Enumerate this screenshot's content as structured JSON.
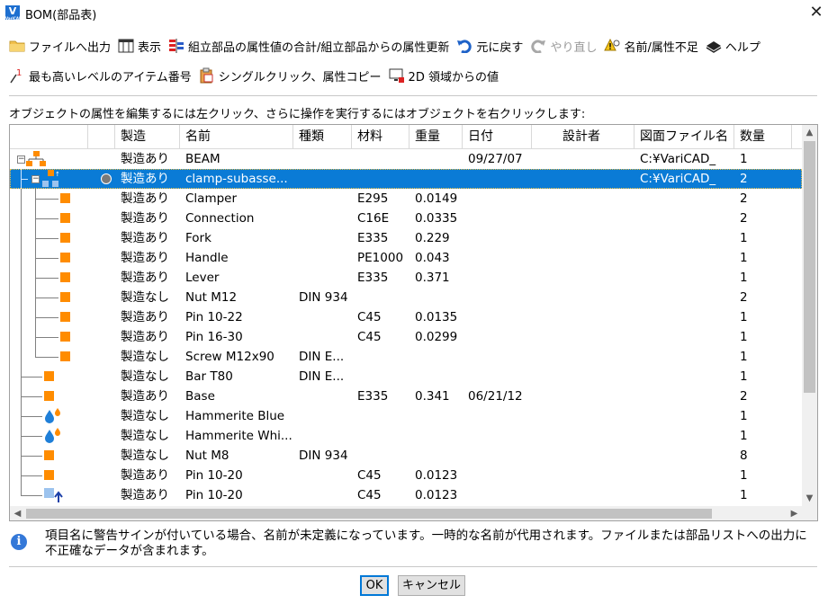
{
  "window": {
    "title": "BOM(部品表)",
    "app_icon_letter": "V",
    "app_icon_sub": "VariCAD"
  },
  "toolbar1": [
    {
      "label": "ファイルへ出力",
      "icon": "folder-icon"
    },
    {
      "label": "表示",
      "icon": "columns-icon"
    },
    {
      "label": "組立部品の属性値の合計/組立部品からの属性更新",
      "icon": "assembly-sum-icon"
    },
    {
      "label": "元に戻す",
      "icon": "undo-icon"
    },
    {
      "label": "やり直し",
      "icon": "redo-icon"
    },
    {
      "label": "名前/属性不足",
      "icon": "warning-icon"
    },
    {
      "label": "ヘルプ",
      "icon": "help-book-icon"
    }
  ],
  "toolbar2": [
    {
      "label": "最も高いレベルのアイテム番号",
      "icon": "top-level-number-icon"
    },
    {
      "label": "シングルクリック、属性コピー",
      "icon": "copy-attribute-icon"
    },
    {
      "label": "2D 領域からの値",
      "icon": "2d-area-icon"
    }
  ],
  "instruction": "オブジェクトの属性を編集するには左クリック、さらに操作を実行するにはオブジェクトを右クリックします:",
  "columns": [
    "製造",
    "名前",
    "種類",
    "材料",
    "重量",
    "日付",
    "設計者",
    "図面ファイル名",
    "数量"
  ],
  "rows": [
    {
      "icon": "assembly",
      "level": 0,
      "expander": "minus",
      "mfg": "製造あり",
      "name": "BEAM",
      "type": "",
      "material": "",
      "weight": "",
      "date": "09/27/07",
      "designer": "",
      "file": "C:¥VariCAD_",
      "qty": "1"
    },
    {
      "icon": "subassembly",
      "level": 1,
      "expander": "minus",
      "selected": true,
      "mfg": "製造あり",
      "name": "clamp-subasse...",
      "type": "",
      "material": "",
      "weight": "",
      "date": "",
      "designer": "",
      "file": "C:¥VariCAD_",
      "qty": "2"
    },
    {
      "icon": "part",
      "level": 2,
      "mfg": "製造あり",
      "name": "Clamper",
      "type": "",
      "material": "E295",
      "weight": "0.0149",
      "date": "",
      "designer": "",
      "file": "",
      "qty": "2"
    },
    {
      "icon": "part",
      "level": 2,
      "mfg": "製造あり",
      "name": "Connection",
      "type": "",
      "material": "C16E",
      "weight": "0.0335",
      "date": "",
      "designer": "",
      "file": "",
      "qty": "2"
    },
    {
      "icon": "part",
      "level": 2,
      "mfg": "製造あり",
      "name": "Fork",
      "type": "",
      "material": "E335",
      "weight": "0.229",
      "date": "",
      "designer": "",
      "file": "",
      "qty": "1"
    },
    {
      "icon": "part",
      "level": 2,
      "mfg": "製造あり",
      "name": "Handle",
      "type": "",
      "material": "PE1000",
      "weight": "0.043",
      "date": "",
      "designer": "",
      "file": "",
      "qty": "1"
    },
    {
      "icon": "part",
      "level": 2,
      "mfg": "製造あり",
      "name": "Lever",
      "type": "",
      "material": "E335",
      "weight": "0.371",
      "date": "",
      "designer": "",
      "file": "",
      "qty": "1"
    },
    {
      "icon": "part",
      "level": 2,
      "mfg": "製造なし",
      "name": "Nut M12",
      "type": "DIN 934",
      "material": "",
      "weight": "",
      "date": "",
      "designer": "",
      "file": "",
      "qty": "2"
    },
    {
      "icon": "part",
      "level": 2,
      "mfg": "製造あり",
      "name": "Pin 10-22",
      "type": "",
      "material": "C45",
      "weight": "0.0135",
      "date": "",
      "designer": "",
      "file": "",
      "qty": "1"
    },
    {
      "icon": "part",
      "level": 2,
      "mfg": "製造あり",
      "name": "Pin 16-30",
      "type": "",
      "material": "C45",
      "weight": "0.0299",
      "date": "",
      "designer": "",
      "file": "",
      "qty": "1"
    },
    {
      "icon": "part",
      "level": 2,
      "last": true,
      "mfg": "製造なし",
      "name": "Screw M12x90",
      "type": "DIN E...",
      "material": "",
      "weight": "",
      "date": "",
      "designer": "",
      "file": "",
      "qty": "1"
    },
    {
      "icon": "part",
      "level": 1,
      "mfg": "製造なし",
      "name": "Bar T80",
      "type": "DIN E...",
      "material": "",
      "weight": "",
      "date": "",
      "designer": "",
      "file": "",
      "qty": "1"
    },
    {
      "icon": "part",
      "level": 1,
      "mfg": "製造あり",
      "name": "Base",
      "type": "",
      "material": "E335",
      "weight": "0.341",
      "date": "06/21/12",
      "designer": "",
      "file": "",
      "qty": "2"
    },
    {
      "icon": "paint",
      "level": 1,
      "mfg": "製造なし",
      "name": "Hammerite Blue",
      "type": "",
      "material": "",
      "weight": "",
      "date": "",
      "designer": "",
      "file": "",
      "qty": "1"
    },
    {
      "icon": "paint",
      "level": 1,
      "mfg": "製造なし",
      "name": "Hammerite Whi...",
      "type": "",
      "material": "",
      "weight": "",
      "date": "",
      "designer": "",
      "file": "",
      "qty": "1"
    },
    {
      "icon": "part",
      "level": 1,
      "mfg": "製造なし",
      "name": "Nut M8",
      "type": "DIN 934",
      "material": "",
      "weight": "",
      "date": "",
      "designer": "",
      "file": "",
      "qty": "8"
    },
    {
      "icon": "part",
      "level": 1,
      "mfg": "製造あり",
      "name": "Pin 10-20",
      "type": "",
      "material": "C45",
      "weight": "0.0123",
      "date": "",
      "designer": "",
      "file": "",
      "qty": "1"
    },
    {
      "icon": "part-linked",
      "level": 1,
      "mfg": "製造あり",
      "name": "Pin 10-20",
      "type": "",
      "material": "C45",
      "weight": "0.0123",
      "date": "",
      "designer": "",
      "file": "",
      "qty": "1"
    }
  ],
  "info_text": "項目名に警告サインが付いている場合、名前が未定義になっています。一時的な名前が代用されます。ファイルまたは部品リストへの出力に不正確なデータが含まれます。",
  "buttons": {
    "ok": "OK",
    "cancel": "キャンセル"
  },
  "colors": {
    "selection": "#0a7bd6",
    "part": "#ff8c00",
    "paint_blue": "#1f7fd8",
    "accent_button": "#0078d7"
  }
}
